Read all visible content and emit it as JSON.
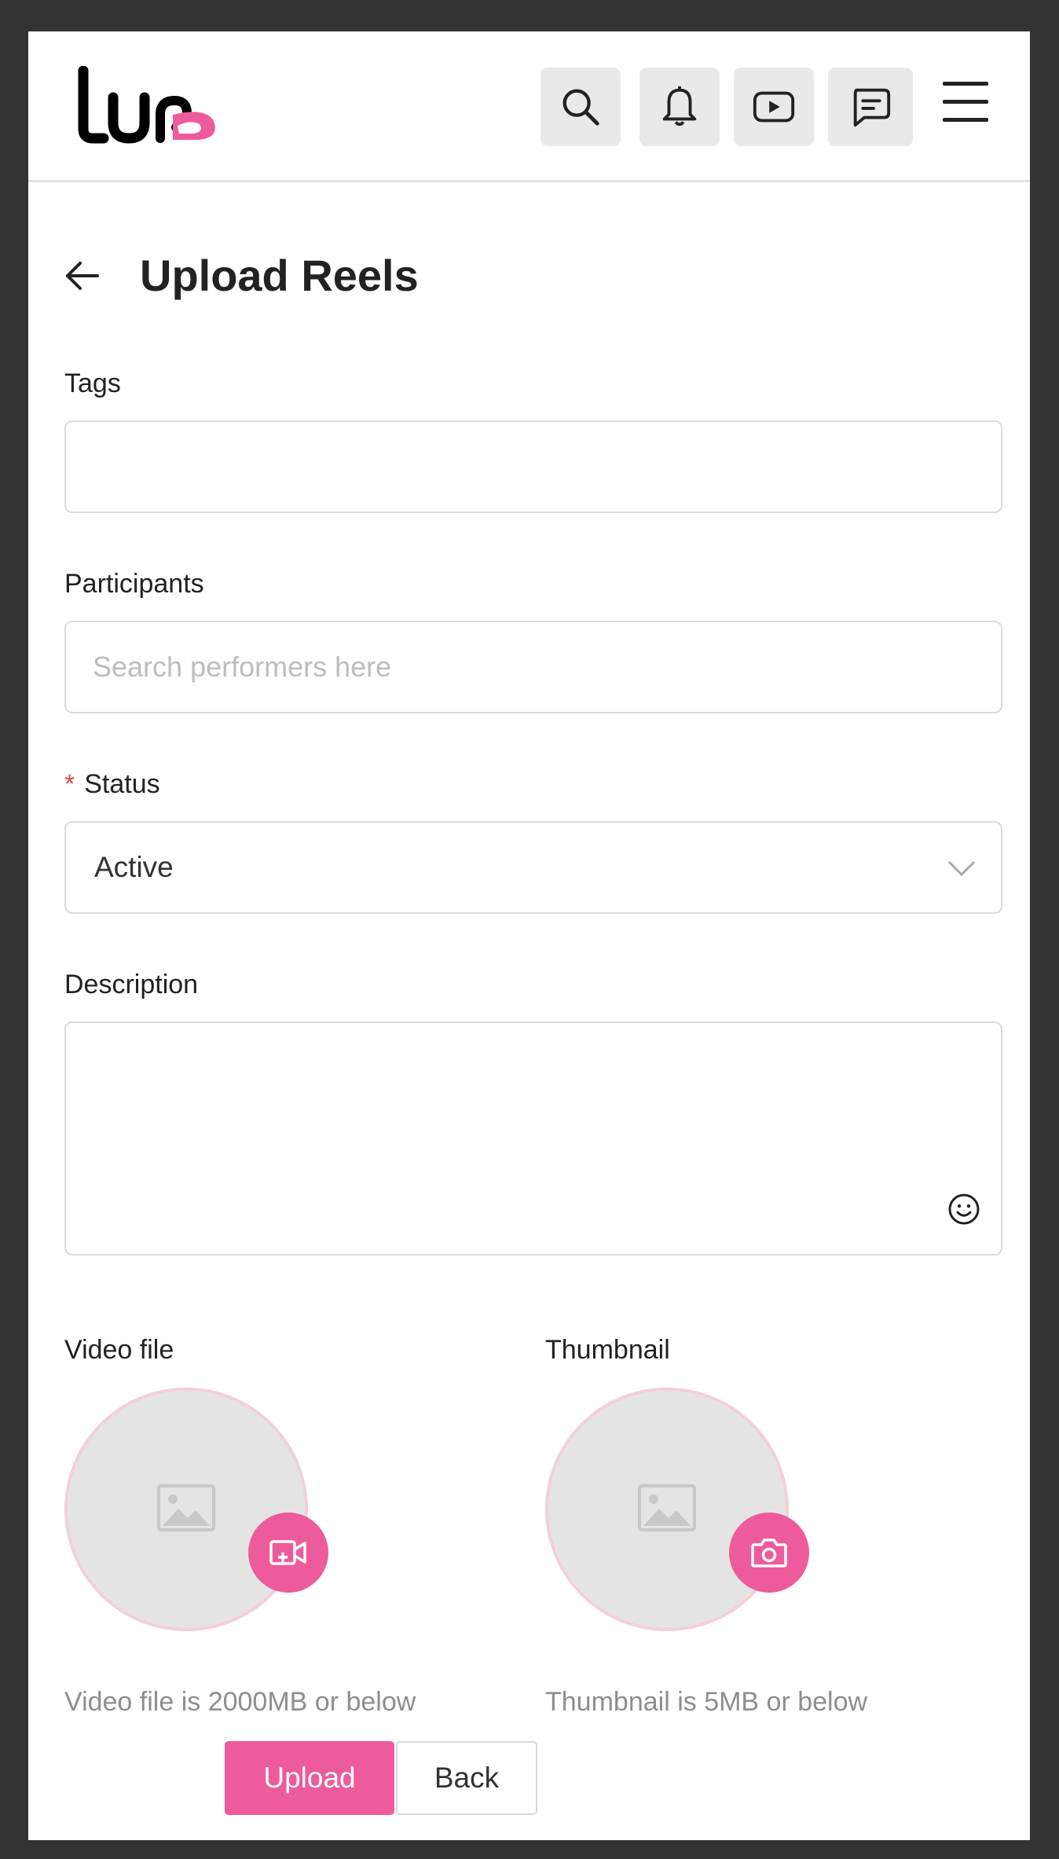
{
  "header": {
    "logo_text": "Lub",
    "icons": [
      "search-icon",
      "bell-icon",
      "video-play-icon",
      "message-icon",
      "hamburger-menu-icon"
    ]
  },
  "page": {
    "title": "Upload Reels"
  },
  "form": {
    "tags": {
      "label": "Tags",
      "value": ""
    },
    "participants": {
      "label": "Participants",
      "placeholder": "Search performers here",
      "value": ""
    },
    "status": {
      "label": "Status",
      "required_marker": "*",
      "value": "Active"
    },
    "description": {
      "label": "Description",
      "value": ""
    },
    "video_file": {
      "label": "Video file",
      "hint": "Video file is 2000MB or below"
    },
    "thumbnail": {
      "label": "Thumbnail",
      "hint": "Thumbnail is 5MB or below"
    }
  },
  "actions": {
    "upload_label": "Upload",
    "back_label": "Back"
  },
  "colors": {
    "accent": "#ee5b9c",
    "required": "#e8493d",
    "background": "#333333"
  }
}
